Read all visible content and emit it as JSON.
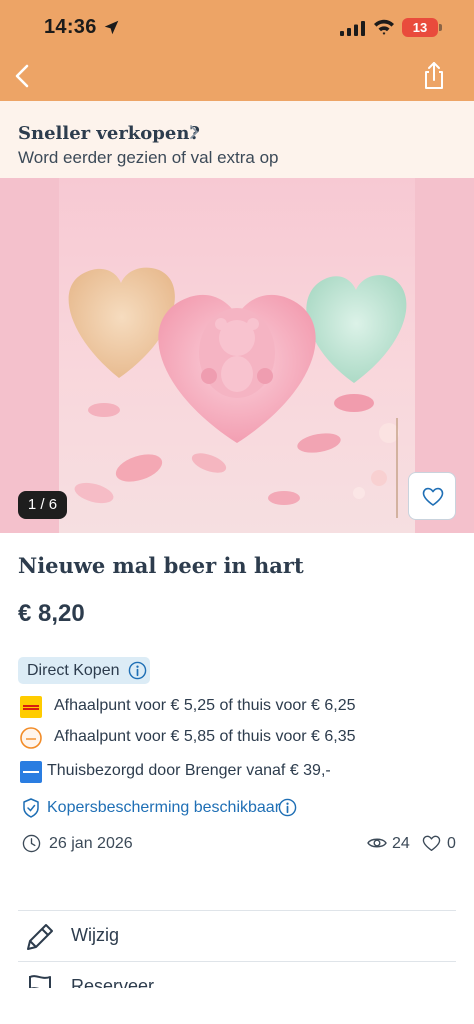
{
  "status_bar": {
    "time": "14:36",
    "battery": "13"
  },
  "promo": {
    "title": "Sneller verkopen?",
    "subtitle": "Word eerder gezien of val extra op"
  },
  "listing": {
    "image_counter": "1 / 6",
    "title": "Nieuwe mal beer in hart",
    "price": "€ 8,20",
    "direct_buy_label": "Direct Kopen",
    "shipping": [
      {
        "carrier_icon": "dhl-icon",
        "text": "Afhaalpunt voor € 5,25 of thuis voor € 6,25"
      },
      {
        "carrier_icon": "postnl-icon",
        "text": "Afhaalpunt voor € 5,85 of thuis voor € 6,35"
      },
      {
        "carrier_icon": "brenger-icon",
        "text": "Thuisbezorgd door Brenger vanaf € 39,-"
      }
    ],
    "buyer_protection": "Kopersbescherming beschikbaar",
    "date": "26 jan 2026",
    "views": "24",
    "favorites": "0"
  },
  "actions": [
    {
      "icon": "pencil-icon",
      "label": "Wijzig"
    },
    {
      "icon": "flag-icon",
      "label": "Reserveer"
    }
  ],
  "colors": {
    "header": "#eda466",
    "promo_bg": "#fdf3ec",
    "badge_bg": "#dcecf6",
    "link": "#1f6fb5",
    "text": "#2d3c4d"
  }
}
